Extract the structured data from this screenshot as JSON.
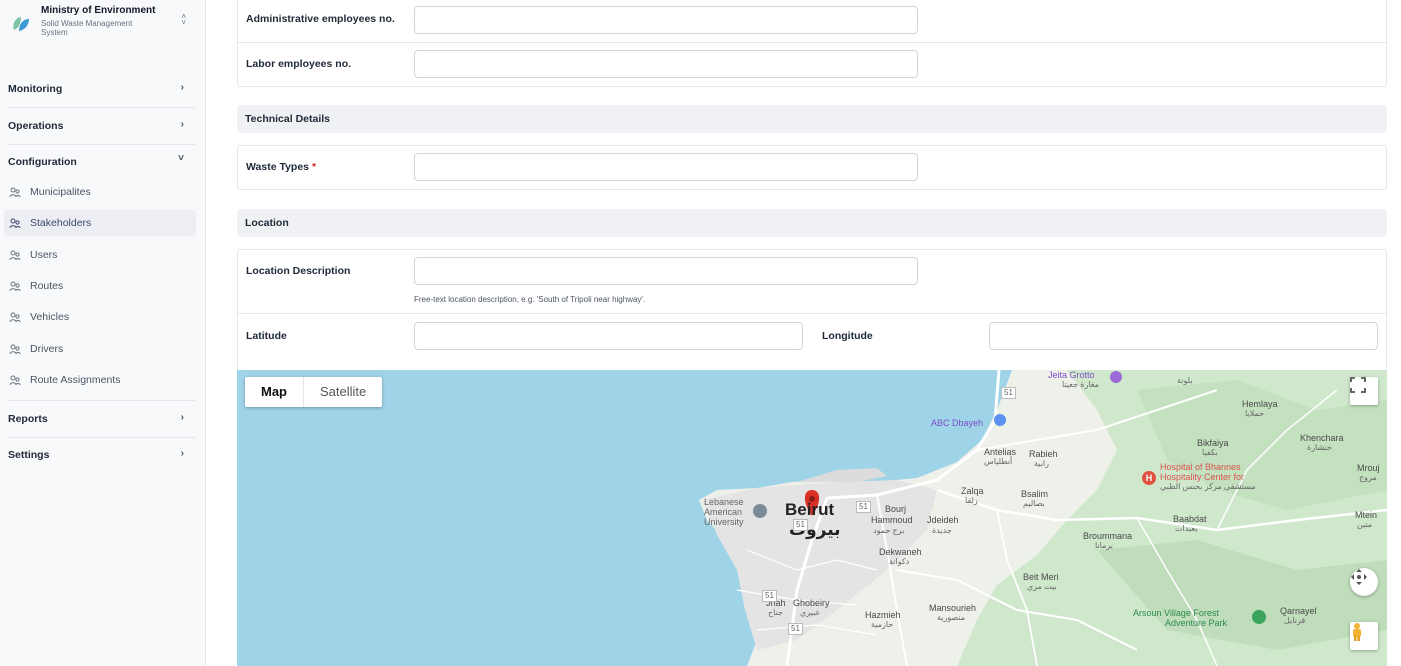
{
  "brand": {
    "title": "Ministry of Environment",
    "subtitle": "Solid Waste Management System",
    "switch_icon": "chevron-up-down-icon"
  },
  "nav": {
    "sections": [
      {
        "label": "Monitoring",
        "expanded": false
      },
      {
        "label": "Operations",
        "expanded": false
      },
      {
        "label": "Configuration",
        "expanded": true
      },
      {
        "label": "Reports",
        "expanded": false
      },
      {
        "label": "Settings",
        "expanded": false
      }
    ],
    "config_items": [
      {
        "label": "Municipalites",
        "active": false
      },
      {
        "label": "Stakeholders",
        "active": true
      },
      {
        "label": "Users",
        "active": false
      },
      {
        "label": "Routes",
        "active": false
      },
      {
        "label": "Vehicles",
        "active": false
      },
      {
        "label": "Drivers",
        "active": false
      },
      {
        "label": "Route Assignments",
        "active": false
      }
    ],
    "item_icon": "users-group-icon"
  },
  "form": {
    "admin_employees": {
      "label": "Administrative employees no.",
      "value": ""
    },
    "labor_employees": {
      "label": "Labor employees no.",
      "value": ""
    },
    "technical_section": "Technical Details",
    "waste_types": {
      "label": "Waste Types",
      "required_mark": "*",
      "value": ""
    },
    "location_section": "Location",
    "location_description": {
      "label": "Location Description",
      "value": "",
      "hint": "Free-text location description, e.g. 'South of Tripoli near highway'."
    },
    "latitude": {
      "label": "Latitude",
      "value": ""
    },
    "longitude": {
      "label": "Longitude",
      "value": ""
    }
  },
  "map": {
    "type_map": "Map",
    "type_satellite": "Satellite",
    "selected_type": "Map",
    "water_color": "#9fd3e8",
    "land_color": "#eef0ea",
    "marker_color": "#d93025",
    "places": {
      "jeita": "Jeita Grotto",
      "jeita_ar": "مغارة جعيتا",
      "ballouneh_ar": "بلونة",
      "hemlaya": "Hemlaya",
      "hemlaya_ar": "حملايا",
      "abc": "ABC Dbayeh",
      "bikfaiya": "Bikfaiya",
      "bikfaiya_ar": "بكفيا",
      "khenchara": "Khenchara",
      "khenchara_ar": "خنشارة",
      "antelias": "Antelias",
      "antelias_ar": "أنطلياس",
      "rabieh": "Rabieh",
      "rabieh_ar": "رابية",
      "hospital1": "Hospital of Bhannes",
      "hospital2": "Hospitality Center for",
      "hospital_ar": "مستشفى مركز بحنس الطبي",
      "mrouj": "Mrouj",
      "mrouj_ar": "مروج",
      "zalqa": "Zalqa",
      "zalqa_ar": "زلقا",
      "bsalim": "Bsalim",
      "bsalim_ar": "بصاليم",
      "lebanese1": "Lebanese",
      "lebanese2": "American",
      "lebanese3": "University",
      "beirut": "Beirut",
      "beirut_ar": "بيروت",
      "bourj": "Bourj",
      "hammoud": "Hammoud",
      "hammoud_ar": "برج حمود",
      "jdeideh": "Jdeideh",
      "jdeideh_ar": "جديدة",
      "baabdat": "Baabdat",
      "baabdat_ar": "بعبدات",
      "mtein": "Mtein",
      "mtein_ar": "متين",
      "broummana": "Broummana",
      "broummana_ar": "برمانا",
      "dekwaneh": "Dekwaneh",
      "dekwaneh_ar": "دكوانة",
      "beit_meri": "Beit Meri",
      "beit_meri_ar": "بيت مري",
      "jnah": "Jnah",
      "ghobeiry": "Ghobeiry",
      "jnah_ar": "جناح",
      "ghobeiry_ar": "غبيري",
      "hazmieh": "Hazmieh",
      "hazmieh_ar": "حازمية",
      "mansourieh": "Mansourieh",
      "mansourieh_ar": "منصورية",
      "arsoun1": "Arsoun Village Forest",
      "arsoun2": "Adventure Park",
      "qarnayel": "Qarnayel",
      "qarnayel_ar": "قرنايل",
      "route51a": "51",
      "route51b": "51",
      "route51c": "51",
      "route51d": "51",
      "route51e": "51"
    }
  }
}
